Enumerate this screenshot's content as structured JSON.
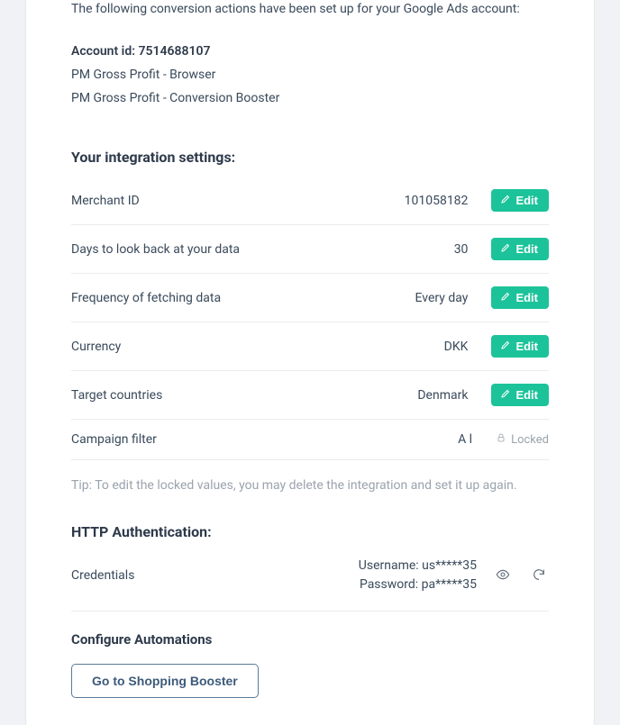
{
  "intro": "The following conversion actions have been set up for your Google Ads account:",
  "account_id_label": "Account id: 7514688107",
  "conversion_actions": [
    "PM Gross Profit - Browser",
    "PM Gross Profit - Conversion Booster"
  ],
  "settings_heading": "Your integration settings:",
  "settings": [
    {
      "label": "Merchant ID",
      "value": "101058182",
      "editable": true
    },
    {
      "label": "Days to look back at your data",
      "value": "30",
      "editable": true
    },
    {
      "label": "Frequency of fetching data",
      "value": "Every day",
      "editable": true
    },
    {
      "label": "Currency",
      "value": "DKK",
      "editable": true
    },
    {
      "label": "Target countries",
      "value": "Denmark",
      "editable": true
    },
    {
      "label": "Campaign filter",
      "value": "A l",
      "editable": false
    }
  ],
  "edit_label": "Edit",
  "locked_label": "Locked",
  "tip_label": "Tip:",
  "tip_text": " To edit the locked values, you may delete the integration and set it up again.",
  "http_auth_heading": "HTTP Authentication:",
  "credentials_label": "Credentials",
  "credentials_username": "Username: us*****35",
  "credentials_password": "Password: pa*****35",
  "configure_heading": "Configure Automations",
  "go_to_booster": "Go to Shopping Booster"
}
